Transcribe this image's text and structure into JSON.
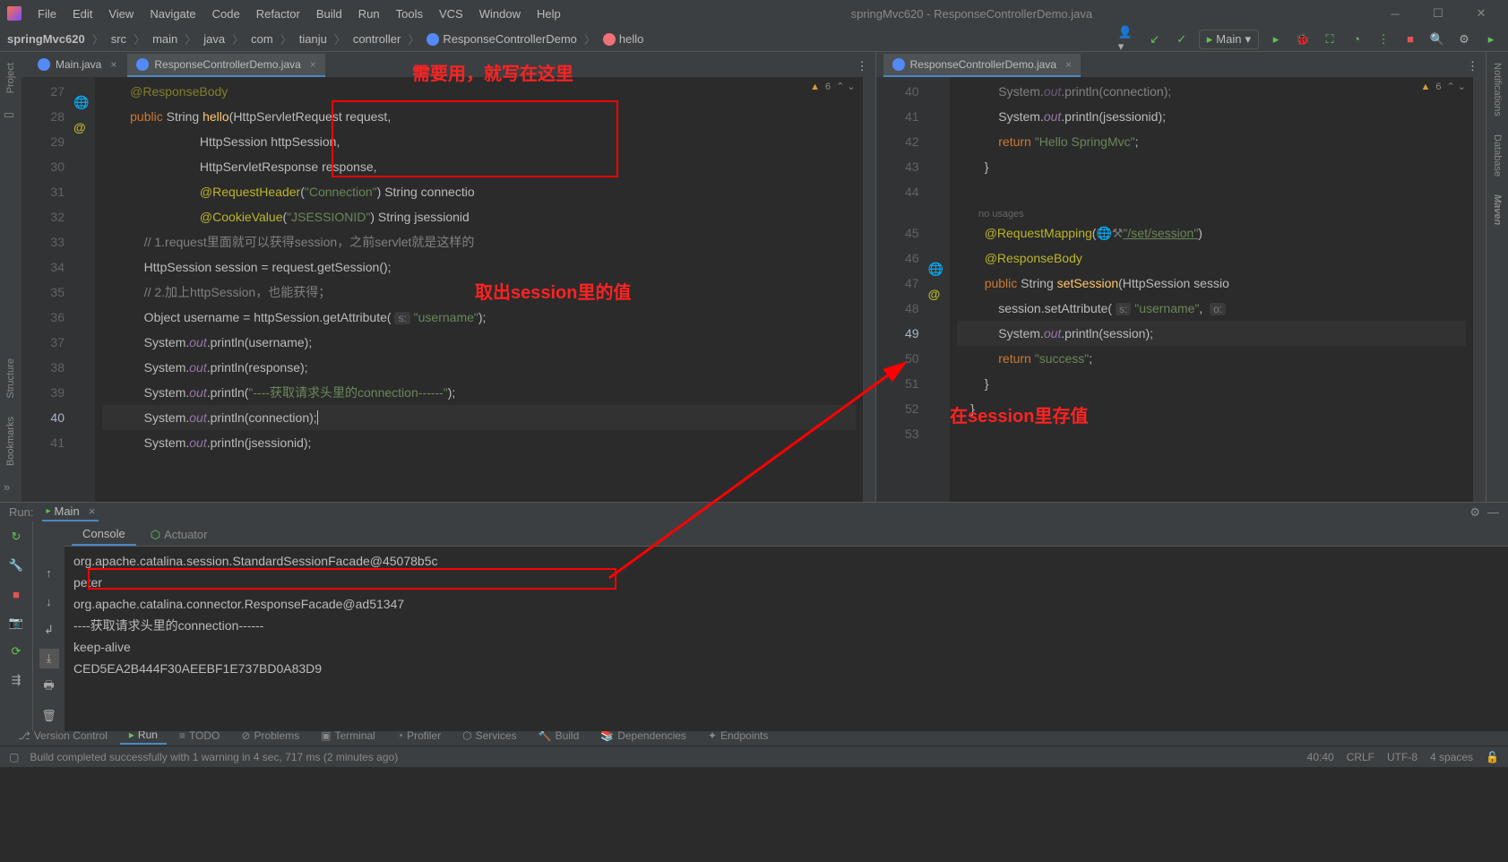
{
  "title": "springMvc620 - ResponseControllerDemo.java",
  "menu": [
    "File",
    "Edit",
    "View",
    "Navigate",
    "Code",
    "Refactor",
    "Build",
    "Run",
    "Tools",
    "VCS",
    "Window",
    "Help"
  ],
  "breadcrumb": {
    "items": [
      "springMvc620",
      "src",
      "main",
      "java",
      "com",
      "tianju",
      "controller"
    ],
    "file": "ResponseControllerDemo",
    "method": "hello"
  },
  "run_config": "Main",
  "tabs_left": [
    {
      "label": "Main.java",
      "active": false
    },
    {
      "label": "ResponseControllerDemo.java",
      "active": true
    }
  ],
  "tabs_right": [
    {
      "label": "ResponseControllerDemo.java",
      "active": true
    }
  ],
  "annotations": {
    "top": "需要用，就写在这里",
    "mid": "取出session里的值",
    "right": "在session里存值"
  },
  "warn_left": "6",
  "warn_right": "6",
  "no_usages": "no usages",
  "left_lines": {
    "start": 27,
    "rows": [
      {
        "n": 27,
        "t": [
          "ann",
          "        @ResponseBody"
        ],
        "dim": true
      },
      {
        "n": 28,
        "code": "        <span class='kw'>public</span> String <span class='mth'>hello</span>(HttpServletRequest request,"
      },
      {
        "n": 29,
        "code": "                            HttpSession httpSession,"
      },
      {
        "n": 30,
        "code": "                            HttpServletResponse response,"
      },
      {
        "n": 31,
        "code": "                            <span class='ann'>@RequestHeader</span>(<span class='str'>\"Connection\"</span>) String connectio"
      },
      {
        "n": 32,
        "code": "                            <span class='ann'>@CookieValue</span>(<span class='str'>\"JSESSIONID\"</span>) String jsessionid"
      },
      {
        "n": 33,
        "code": "            <span class='com'>// 1.request里面就可以获得session，之前servlet就是这样的</span>"
      },
      {
        "n": 34,
        "code": "            HttpSession session = request.getSession();"
      },
      {
        "n": 35,
        "code": "            <span class='com'>// 2.加上httpSession，也能获得；</span>"
      },
      {
        "n": 36,
        "code": "            Object username = httpSession.getAttribute( <span class='hint'>s:</span> <span class='str'>\"username\"</span>);"
      },
      {
        "n": 37,
        "code": "            System.<span class='fld'>out</span>.println(username);"
      },
      {
        "n": 38,
        "code": "            System.<span class='fld'>out</span>.println(response);"
      },
      {
        "n": 39,
        "code": "            System.<span class='fld'>out</span>.println(<span class='str'>\"----获取请求头里的connection------\"</span>);"
      },
      {
        "n": 40,
        "code": "            System.<span class='fld'>out</span>.println(connection);<span style='border-left:1px solid #bbb;'>&nbsp;</span>"
      },
      {
        "n": 41,
        "code": "            System.<span class='fld'>out</span>.println(jsessionid);"
      }
    ]
  },
  "right_lines": {
    "rows": [
      {
        "n": 40,
        "code": "            System.<span class='fld'>out</span>.println(connection);",
        "dim": true
      },
      {
        "n": 41,
        "code": "            System.<span class='fld'>out</span>.println(jsessionid);"
      },
      {
        "n": 42,
        "code": "            <span class='kw'>return</span> <span class='str'>\"Hello SpringMvc\"</span>;"
      },
      {
        "n": 43,
        "code": "        }"
      },
      {
        "n": 44,
        "code": ""
      },
      {
        "n": 45,
        "code": "        <span class='ann'>@RequestMapping</span>(<span style='color:#777;'>&#x1F310;&#x2692;</span><span class='str u'>\"/set/session\"</span>)",
        "nousage": true
      },
      {
        "n": 46,
        "code": "        <span class='ann'>@ResponseBody</span>"
      },
      {
        "n": 47,
        "code": "        <span class='kw'>public</span> String <span class='mth'>setSession</span>(HttpSession sessio",
        "at": true
      },
      {
        "n": 48,
        "code": "            session.setAttribute( <span class='hint'>s:</span> <span class='str'>\"username\"</span>,  <span class='hint'>o:</span>"
      },
      {
        "n": 49,
        "code": "            System.<span class='fld'>out</span>.println(session);",
        "hl": true
      },
      {
        "n": 50,
        "code": "            <span class='kw'>return</span> <span class='str'>\"success\"</span>;"
      },
      {
        "n": 51,
        "code": "        }"
      },
      {
        "n": 52,
        "code": "    }"
      },
      {
        "n": 53,
        "code": ""
      }
    ]
  },
  "run": {
    "label": "Run:",
    "name": "Main",
    "tabs": [
      "Console",
      "Actuator"
    ],
    "lines": [
      "org.apache.catalina.session.StandardSessionFacade@45078b5c",
      "peter",
      "org.apache.catalina.connector.ResponseFacade@ad51347",
      "----获取请求头里的connection------",
      "keep-alive",
      "CED5EA2B444F30AEEBF1E737BD0A83D9"
    ]
  },
  "bottom_tabs": [
    "Version Control",
    "Run",
    "TODO",
    "Problems",
    "Terminal",
    "Profiler",
    "Services",
    "Build",
    "Dependencies",
    "Endpoints"
  ],
  "status": {
    "msg": "Build completed successfully with 1 warning in 4 sec, 717 ms (2 minutes ago)",
    "pos": "40:40",
    "eol": "CRLF",
    "enc": "UTF-8",
    "indent": "4 spaces"
  },
  "sidebar_left": [
    "Project",
    "Bookmarks",
    "Structure"
  ],
  "sidebar_right": [
    "Notifications",
    "Database",
    "Maven"
  ]
}
